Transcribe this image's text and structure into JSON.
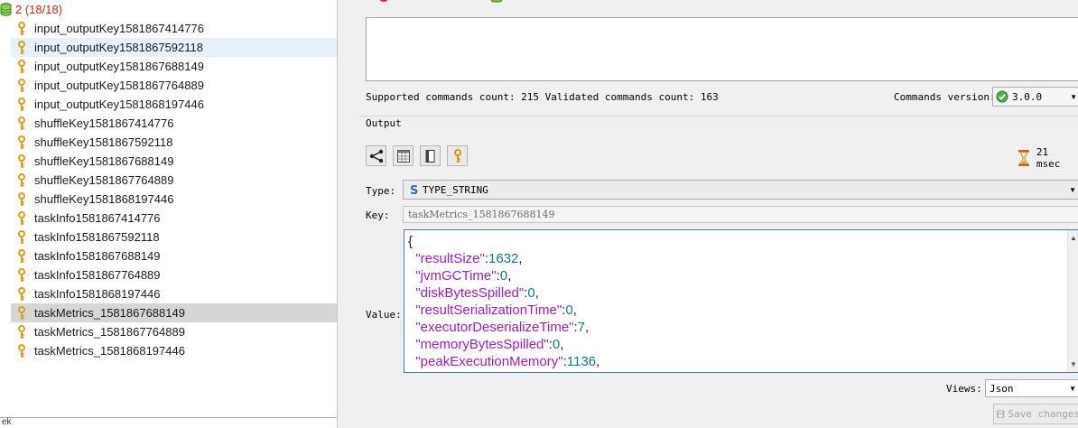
{
  "tree": {
    "database_label": "2 (18/18)",
    "items": [
      {
        "label": "input_outputKey1581867414776",
        "icon": "key-icon"
      },
      {
        "label": "input_outputKey1581867592118",
        "icon": "key-icon"
      },
      {
        "label": "input_outputKey1581867688149",
        "icon": "key-icon"
      },
      {
        "label": "input_outputKey1581867764889",
        "icon": "key-icon"
      },
      {
        "label": "input_outputKey1581868197446",
        "icon": "key-icon"
      },
      {
        "label": "shuffleKey1581867414776",
        "icon": "key-icon"
      },
      {
        "label": "shuffleKey1581867592118",
        "icon": "key-icon"
      },
      {
        "label": "shuffleKey1581867688149",
        "icon": "key-icon"
      },
      {
        "label": "shuffleKey1581867764889",
        "icon": "key-icon"
      },
      {
        "label": "shuffleKey1581868197446",
        "icon": "key-icon"
      },
      {
        "label": "taskInfo1581867414776",
        "icon": "key-icon"
      },
      {
        "label": "taskInfo1581867592118",
        "icon": "key-icon"
      },
      {
        "label": "taskInfo1581867688149",
        "icon": "key-icon"
      },
      {
        "label": "taskInfo1581867764889",
        "icon": "key-icon"
      },
      {
        "label": "taskInfo1581868197446",
        "icon": "key-icon"
      },
      {
        "label": "taskMetrics_1581867688149",
        "icon": "key-icon"
      },
      {
        "label": "taskMetrics_1581867764889",
        "icon": "key-icon"
      },
      {
        "label": "taskMetrics_1581868197446",
        "icon": "key-icon"
      }
    ],
    "hovered_index": 1,
    "selected_index": 15,
    "bottom_fragment": "ek"
  },
  "console": {
    "status_text": "Supported commands count: 215 Validated commands count: 163",
    "version_label": "Commands version:",
    "version_value": "3.0.0"
  },
  "output": {
    "group_title": "Output",
    "timing": "21 msec",
    "type_label": "Type:",
    "type_value": "TYPE_STRING",
    "key_label": "Key:",
    "key_value": "taskMetrics_1581867688149",
    "value_label": "Value:",
    "json_open": "{",
    "json_fields": [
      {
        "key": "\"resultSize\"",
        "value": "1632"
      },
      {
        "key": "\"jvmGCTime\"",
        "value": "0"
      },
      {
        "key": "\"diskBytesSpilled\"",
        "value": "0"
      },
      {
        "key": "\"resultSerializationTime\"",
        "value": "0"
      },
      {
        "key": "\"executorDeserializeTime\"",
        "value": "7"
      },
      {
        "key": "\"memoryBytesSpilled\"",
        "value": "0"
      },
      {
        "key": "\"peakExecutionMemory\"",
        "value": "1136"
      }
    ],
    "views_label": "Views:",
    "views_value": "Json",
    "save_label": "Save changes"
  },
  "colors": {
    "db_label": "#d4221c",
    "json_key": "#9b1fbf",
    "json_number": "#0f7d83",
    "value_border": "#3c7fb1",
    "hover_row": "#e6f1fb",
    "selected_row": "#d6d6d6"
  }
}
